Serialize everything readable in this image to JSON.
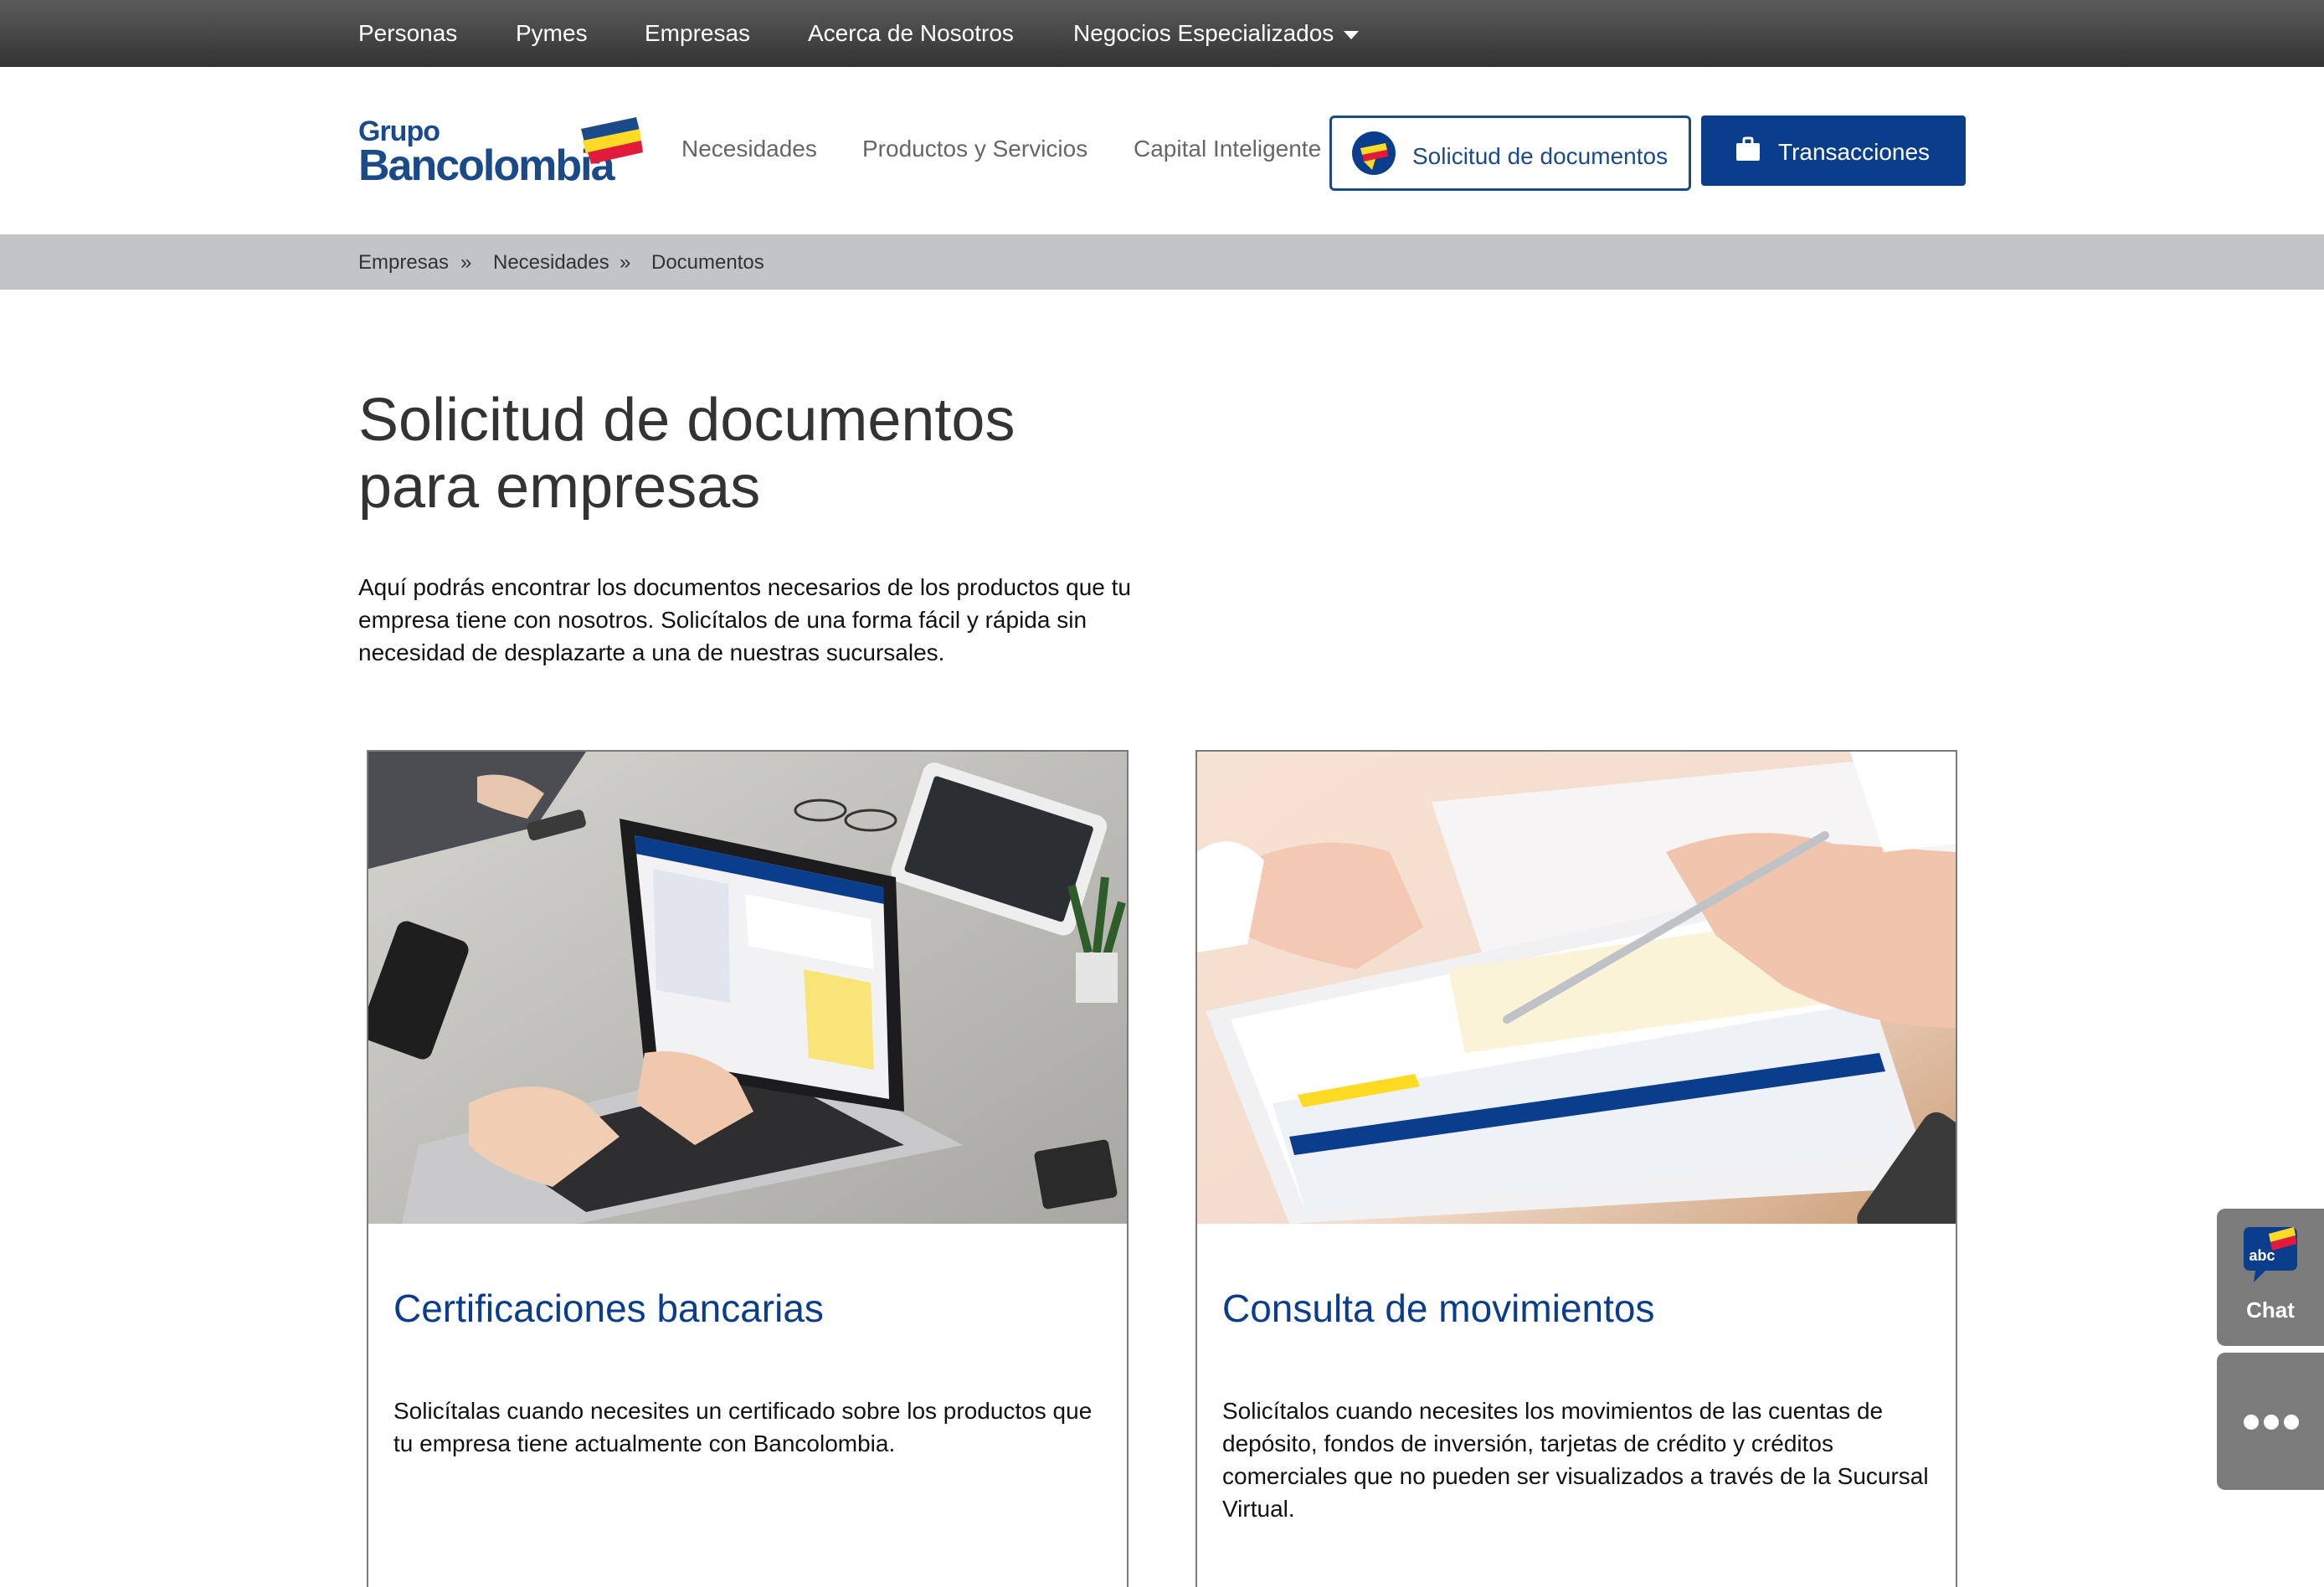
{
  "top_nav": {
    "items": [
      "Personas",
      "Pymes",
      "Empresas",
      "Acerca de Nosotros",
      "Negocios Especializados"
    ]
  },
  "logo": {
    "line1": "Grupo",
    "line2": "Bancolombia"
  },
  "main_nav": {
    "items": [
      "Necesidades",
      "Productos y Servicios",
      "Capital Inteligente"
    ]
  },
  "header_buttons": {
    "documents_label": "Solicitud de documentos",
    "transactions_label": "Transacciones",
    "documents_icon": "document-request-icon",
    "transactions_icon": "briefcase-icon"
  },
  "breadcrumb": {
    "items": [
      "Empresas",
      "Necesidades",
      "Documentos"
    ],
    "separator": "»"
  },
  "page": {
    "title_line1": "Solicitud de documentos",
    "title_line2": "para empresas",
    "intro": "Aquí podrás encontrar los documentos necesarios de los productos que tu empresa tiene con nosotros. Solicítalos de una forma fácil y rápida sin necesidad de desplazarte a una de nuestras sucursales."
  },
  "cards": [
    {
      "title": "Certificaciones bancarias",
      "description": "Solicítalas cuando necesites un certificado sobre los productos que tu empresa tiene actualmente con Bancolombia.",
      "image": "laptop-office-photo"
    },
    {
      "title": "Consulta de movimientos",
      "description": "Solicítalos cuando necesites los movimientos de las cuentas de depósito, fondos de inversión, tarjetas de crédito y créditos comerciales que no pueden ser visualizados a través de la Sucursal Virtual.",
      "image": "tablet-pen-photo"
    }
  ],
  "widgets": {
    "chat_badge": "abc",
    "chat_label": "Chat",
    "more_icon": "more-dots-icon"
  },
  "colors": {
    "brand_blue": "#0a3d8c",
    "logo_blue": "#1b4a8b",
    "brand_yellow": "#fdda24",
    "brand_red": "#e21b3c",
    "topnav_dark": "#333333",
    "breadcrumb_gray": "#c3c4c7"
  }
}
